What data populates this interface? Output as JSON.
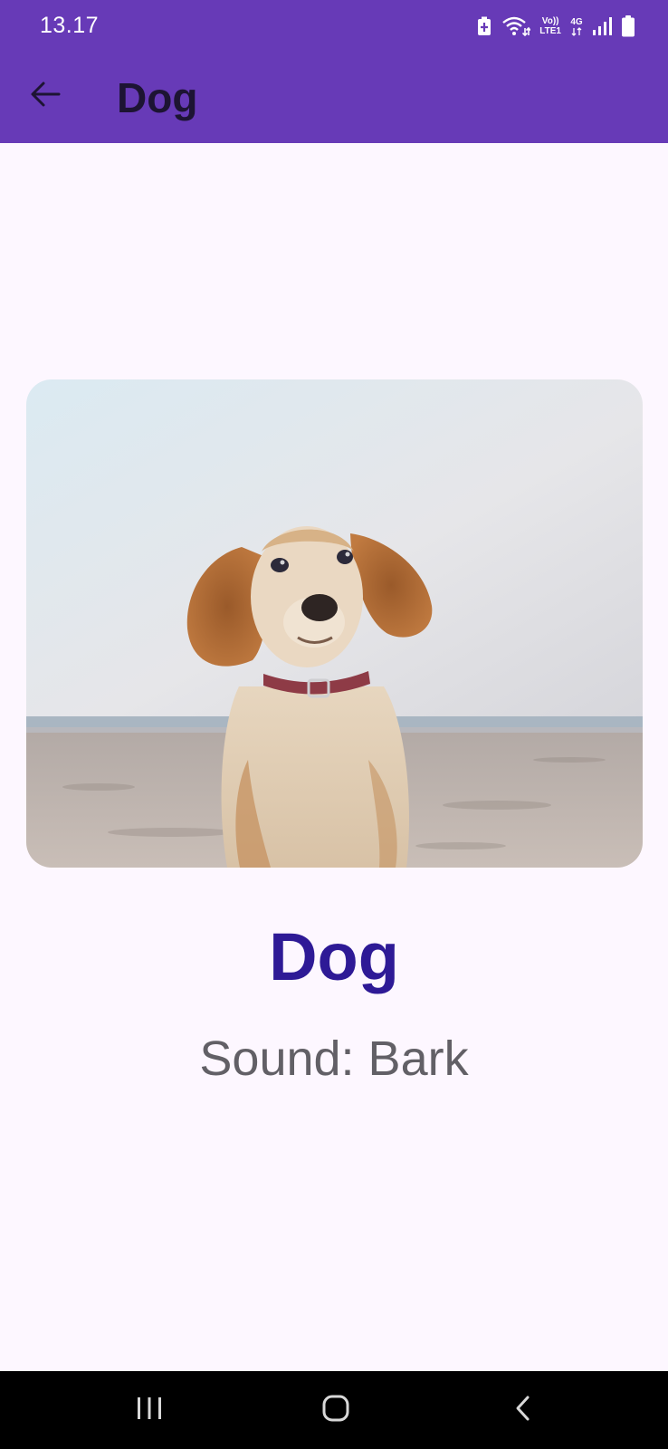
{
  "status_bar": {
    "time": "13.17",
    "volte_top": "Vo))",
    "volte_bottom": "LTE1",
    "network_type": "4G",
    "icons": [
      "battery-saver-icon",
      "wifi-icon",
      "volte-icon",
      "4g-data-icon",
      "signal-icon",
      "battery-icon"
    ]
  },
  "app_bar": {
    "title": "Dog",
    "back_icon": "arrow-back-icon"
  },
  "content": {
    "image_subject": "dog-photo",
    "name": "Dog",
    "sound": "Sound: Bark"
  },
  "nav_bar": {
    "icons": [
      "recent-apps-icon",
      "home-icon",
      "back-icon"
    ]
  },
  "colors": {
    "app_bar": "#673ab7",
    "background": "#fdf7ff",
    "title_text": "#1d1433",
    "name_text": "#2e1a96",
    "sound_text": "#626066"
  }
}
